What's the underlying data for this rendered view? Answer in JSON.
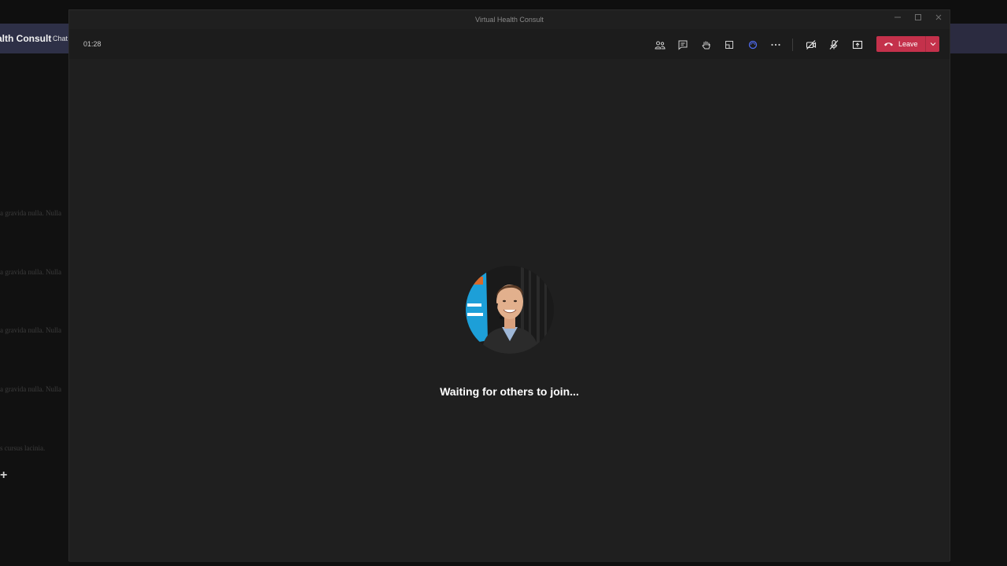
{
  "background": {
    "app_title": "alth Consult",
    "chat_tab": "Chat",
    "faded_lines": [
      "a gravida nulla. Nulla",
      "a gravida nulla. Nulla",
      "a gravida nulla. Nulla",
      "a gravida nulla. Nulla",
      "s cursus lacinia."
    ]
  },
  "window": {
    "title": "Virtual Health Consult",
    "controls": [
      "minimize-icon",
      "maximize-icon",
      "close-icon"
    ]
  },
  "toolbar": {
    "timer": "01:28",
    "icons": [
      "people-icon",
      "chat-icon",
      "raise-hand-icon",
      "rooms-icon",
      "effects-icon",
      "more-icon"
    ],
    "media_icons": [
      "camera-off-icon",
      "mic-off-icon",
      "share-screen-icon"
    ],
    "leave_label": "Leave"
  },
  "stage": {
    "status_text": "Waiting for others to join..."
  },
  "colors": {
    "leave": "#c4314b",
    "stage": "#1f1f1f",
    "header": "#2b2b40",
    "accent_icon": "#4f6bed"
  }
}
